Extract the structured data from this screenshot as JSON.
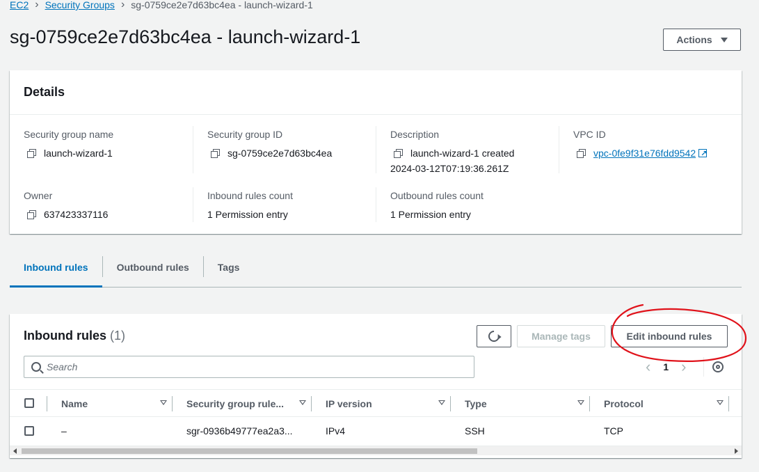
{
  "breadcrumb": {
    "items": [
      "EC2",
      "Security Groups"
    ],
    "current": "sg-0759ce2e7d63bc4ea - launch-wizard-1"
  },
  "page": {
    "title": "sg-0759ce2e7d63bc4ea - launch-wizard-1",
    "actions_label": "Actions"
  },
  "details": {
    "header": "Details",
    "sg_name_label": "Security group name",
    "sg_name_value": "launch-wizard-1",
    "sg_id_label": "Security group ID",
    "sg_id_value": "sg-0759ce2e7d63bc4ea",
    "description_label": "Description",
    "description_line1": "launch-wizard-1 created",
    "description_line2": "2024-03-12T07:19:36.261Z",
    "vpc_label": "VPC ID",
    "vpc_value": "vpc-0fe9f31e76fdd9542",
    "owner_label": "Owner",
    "owner_value": "637423337116",
    "inbound_count_label": "Inbound rules count",
    "inbound_count_value": "1 Permission entry",
    "outbound_count_label": "Outbound rules count",
    "outbound_count_value": "1 Permission entry"
  },
  "tabs": [
    "Inbound rules",
    "Outbound rules",
    "Tags"
  ],
  "inbound": {
    "title": "Inbound rules",
    "count": "(1)",
    "manage_tags_label": "Manage tags",
    "edit_label": "Edit inbound rules",
    "search_placeholder": "Search",
    "page": "1",
    "columns": [
      "Name",
      "Security group rule...",
      "IP version",
      "Type",
      "Protocol"
    ],
    "rows": [
      {
        "name": "–",
        "rule_id": "sgr-0936b49777ea2a3...",
        "ip_version": "IPv4",
        "type": "SSH",
        "protocol": "TCP"
      }
    ]
  },
  "colors": {
    "link": "#0073bb",
    "annotation": "#e0121a",
    "background": "#f2f3f3"
  }
}
